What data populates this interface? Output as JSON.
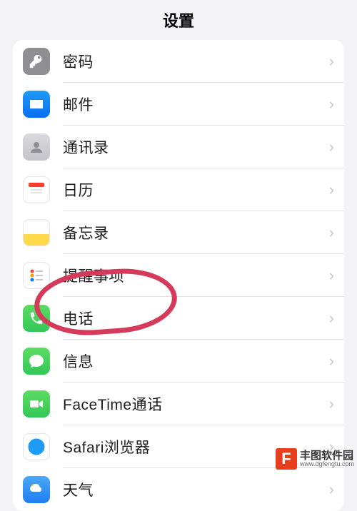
{
  "header": {
    "title": "设置"
  },
  "rows": [
    {
      "key": "passwords",
      "label": "密码",
      "icon": "key-icon"
    },
    {
      "key": "mail",
      "label": "邮件",
      "icon": "mail-icon"
    },
    {
      "key": "contacts",
      "label": "通讯录",
      "icon": "contacts-icon"
    },
    {
      "key": "calendar",
      "label": "日历",
      "icon": "calendar-icon"
    },
    {
      "key": "notes",
      "label": "备忘录",
      "icon": "notes-icon"
    },
    {
      "key": "reminders",
      "label": "提醒事项",
      "icon": "reminders-icon"
    },
    {
      "key": "phone",
      "label": "电话",
      "icon": "phone-icon"
    },
    {
      "key": "messages",
      "label": "信息",
      "icon": "messages-icon"
    },
    {
      "key": "facetime",
      "label": "FaceTime通话",
      "icon": "facetime-icon"
    },
    {
      "key": "safari",
      "label": "Safari浏览器",
      "icon": "safari-icon"
    },
    {
      "key": "weather",
      "label": "天气",
      "icon": "weather-icon"
    }
  ],
  "watermark": {
    "logo_letter": "F",
    "name_cn": "丰图软件园",
    "name_en": "www.dgfengtu.com"
  },
  "colors": {
    "annotation": "#d63a5a"
  }
}
